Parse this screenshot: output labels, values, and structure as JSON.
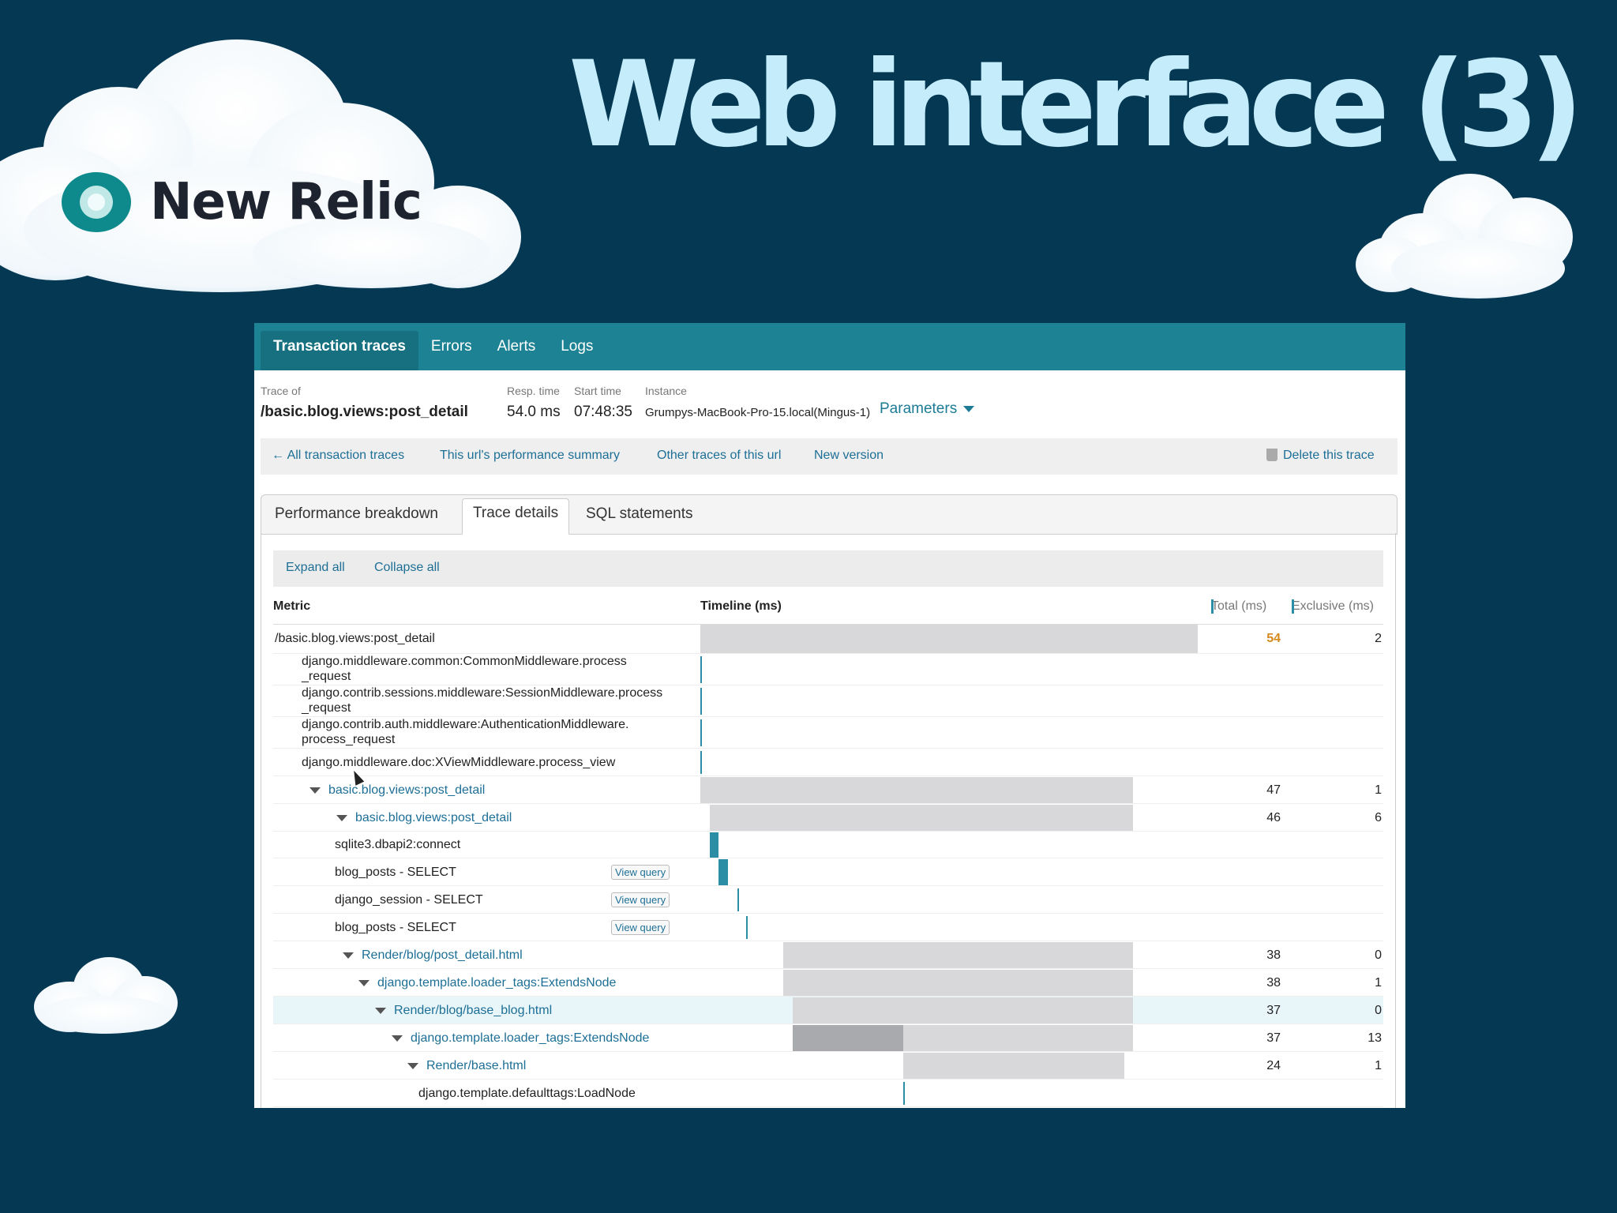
{
  "slide": {
    "title": "Web interface (3)",
    "logo_text": "New Relic"
  },
  "nav": {
    "tabs": [
      {
        "label": "Transaction traces",
        "active": true
      },
      {
        "label": "Errors",
        "active": false
      },
      {
        "label": "Alerts",
        "active": false
      },
      {
        "label": "Logs",
        "active": false
      }
    ]
  },
  "meta": {
    "trace_of_label": "Trace of",
    "trace_of": "/basic.blog.views:post_detail",
    "resp_label": "Resp. time",
    "resp": "54.0 ms",
    "start_label": "Start time",
    "start": "07:48:35",
    "instance_label": "Instance",
    "instance": "Grumpys-MacBook-Pro-15.local(Mingus-1)",
    "parameters": "Parameters"
  },
  "links": {
    "all": "← All transaction traces",
    "summary": "This url's performance summary",
    "other": "Other traces of this url",
    "new_version": "New version",
    "delete": "Delete this trace"
  },
  "subtabs": {
    "performance": "Performance breakdown",
    "trace": "Trace details",
    "sql": "SQL statements"
  },
  "controls": {
    "expand": "Expand all",
    "collapse": "Collapse all"
  },
  "columns": {
    "metric": "Metric",
    "timeline": "Timeline (ms)",
    "total": "Total (ms)",
    "exclusive": "Exclusive (ms)"
  },
  "colors": {
    "accent": "#1d8394",
    "link": "#1d6f96",
    "warn": "#d5891b",
    "bar": "#d8d8da",
    "bar_dark": "#a9aaad",
    "tick": "#2b8ea4"
  },
  "rows": [
    {
      "name": "/basic.blog.views:post_detail",
      "indent": 0,
      "link": false,
      "caret": false,
      "total": "54",
      "exclusive": "2",
      "warn": true
    },
    {
      "name": "django.middleware.common:CommonMiddleware.process\n_request",
      "indent": 1,
      "link": false,
      "caret": false,
      "total": "",
      "exclusive": "",
      "warn": false
    },
    {
      "name": "django.contrib.sessions.middleware:SessionMiddleware.process\n_request",
      "indent": 1,
      "link": false,
      "caret": false,
      "total": "",
      "exclusive": "",
      "warn": false
    },
    {
      "name": "django.contrib.auth.middleware:AuthenticationMiddleware.\nprocess_request",
      "indent": 1,
      "link": false,
      "caret": false,
      "total": "",
      "exclusive": "",
      "warn": false
    },
    {
      "name": "django.middleware.doc:XViewMiddleware.process_view",
      "indent": 1,
      "link": false,
      "caret": false,
      "total": "",
      "exclusive": "",
      "warn": false
    },
    {
      "name": "basic.blog.views:post_detail",
      "indent": 1,
      "link": true,
      "caret": true,
      "total": "47",
      "exclusive": "1",
      "warn": false
    },
    {
      "name": "basic.blog.views:post_detail",
      "indent": 2,
      "link": true,
      "caret": true,
      "total": "46",
      "exclusive": "6",
      "warn": false
    },
    {
      "name": "sqlite3.dbapi2:connect",
      "indent": 3,
      "link": false,
      "caret": false,
      "total": "",
      "exclusive": "",
      "warn": false
    },
    {
      "name": "blog_posts - SELECT",
      "indent": 3,
      "link": false,
      "caret": false,
      "total": "",
      "exclusive": "",
      "warn": false,
      "view_query": "View query"
    },
    {
      "name": "django_session - SELECT",
      "indent": 3,
      "link": false,
      "caret": false,
      "total": "",
      "exclusive": "",
      "warn": false,
      "view_query": "View query"
    },
    {
      "name": "blog_posts - SELECT",
      "indent": 3,
      "link": false,
      "caret": false,
      "total": "",
      "exclusive": "",
      "warn": false,
      "view_query": "View query"
    },
    {
      "name": "Render/blog/post_detail.html",
      "indent": 3,
      "link": true,
      "caret": true,
      "total": "38",
      "exclusive": "0",
      "warn": false
    },
    {
      "name": "django.template.loader_tags:ExtendsNode",
      "indent": 4,
      "link": true,
      "caret": true,
      "total": "38",
      "exclusive": "1",
      "warn": false
    },
    {
      "name": "Render/blog/base_blog.html",
      "indent": 5,
      "link": true,
      "caret": true,
      "total": "37",
      "exclusive": "0",
      "warn": false,
      "highlight": true
    },
    {
      "name": "django.template.loader_tags:ExtendsNode",
      "indent": 6,
      "link": true,
      "caret": true,
      "total": "37",
      "exclusive": "13",
      "warn": false
    },
    {
      "name": "Render/base.html",
      "indent": 7,
      "link": true,
      "caret": true,
      "total": "24",
      "exclusive": "1",
      "warn": false
    },
    {
      "name": "django.template.defaulttags:LoadNode",
      "indent": 8,
      "link": false,
      "caret": false,
      "total": "",
      "exclusive": "",
      "warn": false
    }
  ],
  "timeline": {
    "scale_ms": 54,
    "segments": [
      {
        "start": 0,
        "dur": 54,
        "style": "bar"
      },
      {
        "start": 0,
        "dur": 0,
        "style": "tick"
      },
      {
        "start": 0,
        "dur": 0,
        "style": "tick"
      },
      {
        "start": 0,
        "dur": 0,
        "style": "tick"
      },
      {
        "start": 0,
        "dur": 0,
        "style": "tick"
      },
      {
        "start": 0,
        "dur": 47,
        "style": "bar"
      },
      {
        "start": 1,
        "dur": 46,
        "style": "bar"
      },
      {
        "start": 1,
        "dur": 1,
        "style": "solid"
      },
      {
        "start": 2,
        "dur": 1,
        "style": "solid"
      },
      {
        "start": 4,
        "dur": 0,
        "style": "tick"
      },
      {
        "start": 5,
        "dur": 0,
        "style": "tick"
      },
      {
        "start": 9,
        "dur": 38,
        "style": "bar"
      },
      {
        "start": 9,
        "dur": 38,
        "style": "bar"
      },
      {
        "start": 10,
        "dur": 37,
        "style": "bar"
      },
      {
        "start": 10,
        "dur": 37,
        "style": "bar",
        "dark_dur": 12
      },
      {
        "start": 22,
        "dur": 24,
        "style": "bar"
      },
      {
        "start": 22,
        "dur": 0,
        "style": "tick"
      }
    ]
  }
}
